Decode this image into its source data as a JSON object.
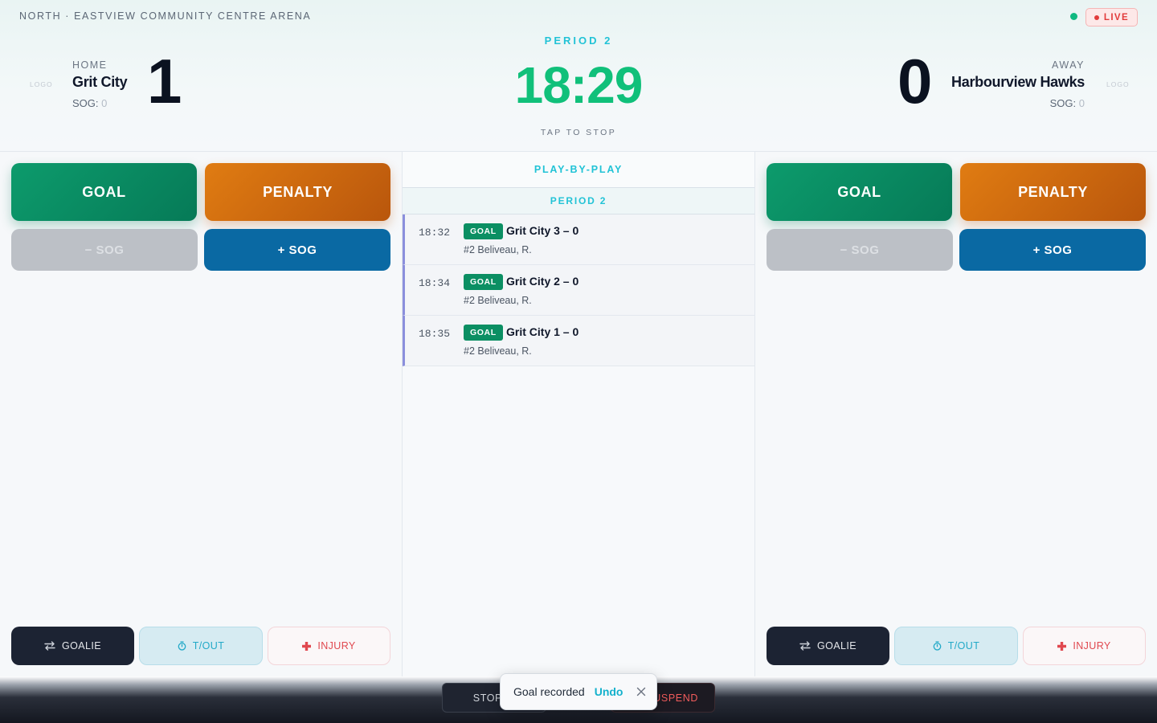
{
  "header": {
    "venue": "NORTH · EASTVIEW COMMUNITY CENTRE ARENA",
    "live_label": "LIVE",
    "period_label": "PERIOD 2",
    "clock": "18:29",
    "tap_hint": "TAP TO STOP",
    "home": {
      "logo_placeholder": "LOGO",
      "side_label": "HOME",
      "team_name": "Grit City",
      "sog_label": "SOG:",
      "sog_value": "0",
      "score": "1"
    },
    "away": {
      "logo_placeholder": "LOGO",
      "side_label": "AWAY",
      "team_name": "Harbourview Hawks",
      "sog_label": "SOG:",
      "sog_value": "0",
      "score": "0"
    }
  },
  "home_panel": {
    "goal_label": "GOAL",
    "penalty_label": "PENALTY",
    "sog_minus_label": "− SOG",
    "sog_plus_label": "+ SOG",
    "goalie_label": "GOALIE",
    "timeout_label": "T/OUT",
    "injury_label": "INJURY"
  },
  "away_panel": {
    "goal_label": "GOAL",
    "penalty_label": "PENALTY",
    "sog_minus_label": "− SOG",
    "sog_plus_label": "+ SOG",
    "goalie_label": "GOALIE",
    "timeout_label": "T/OUT",
    "injury_label": "INJURY"
  },
  "feed": {
    "title": "PLAY-BY-PLAY",
    "period_header": "PERIOD 2",
    "events": [
      {
        "time": "18:32",
        "type": "GOAL",
        "summary": "Grit City 3 – 0",
        "player": "#2 Beliveau, R."
      },
      {
        "time": "18:34",
        "type": "GOAL",
        "summary": "Grit City 2 – 0",
        "player": "#2 Beliveau, R."
      },
      {
        "time": "18:35",
        "type": "GOAL",
        "summary": "Grit City 1 – 0",
        "player": "#2 Beliveau, R."
      }
    ]
  },
  "bottom_bar": {
    "stoppage_label": "STOPPAGE",
    "suspend_label": "SUSPEND"
  },
  "toast": {
    "message": "Goal recorded",
    "undo_label": "Undo"
  },
  "colors": {
    "accent_cyan": "#22c3d6",
    "clock_green": "#10c07a",
    "goal_green": "#0b8f63",
    "penalty_orange": "#d06a10",
    "sog_blue": "#0a69a3",
    "live_red": "#e23b3b"
  },
  "icons": {
    "goalie": "swap-arrows-icon",
    "timeout": "stopwatch-icon",
    "injury": "medical-cross-icon",
    "toast_close": "close-icon"
  }
}
